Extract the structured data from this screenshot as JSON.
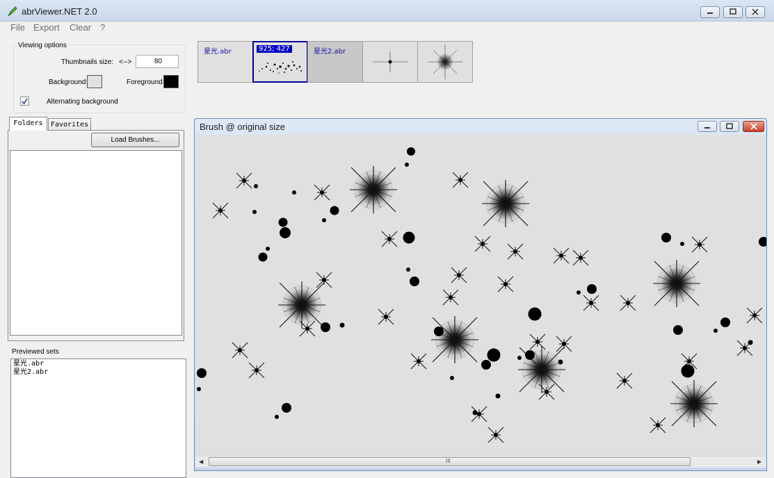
{
  "window": {
    "title": "abrViewer.NET 2.0"
  },
  "menu": {
    "items": [
      "File",
      "Export",
      "Clear",
      "?"
    ]
  },
  "viewing_options": {
    "title": "Viewing options",
    "thumbnails_size_label": "Thumbnails size:",
    "thumbnails_size_arrow": "<-->",
    "thumbnails_size_value": "80",
    "background_label": "Background:",
    "background_color": "#e0e0e0",
    "foreground_label": "Foreground:",
    "foreground_color": "#000000",
    "alternating_label": "Alternating background",
    "alternating_checked": true
  },
  "tabs": {
    "folders": "Folders",
    "favorites": "Favorites",
    "active": "Folders"
  },
  "load_button": "Load Brushes...",
  "previewed_sets": {
    "title": "Previewed sets",
    "items": [
      "星光.abr",
      "星光2.abr"
    ]
  },
  "thumbnails": [
    {
      "name": "星光.abr",
      "selected": false
    },
    {
      "label": "925; 427",
      "selected": true
    },
    {
      "name": "星光2.abr",
      "selected": false
    },
    {
      "icon": "small-star-brush",
      "selected": false
    },
    {
      "icon": "large-star-brush",
      "selected": false
    }
  ],
  "brush_window": {
    "title": "Brush @ original size",
    "scroll_grip": "III"
  },
  "colors": {
    "selection_border": "#0000a0",
    "selection_label_bg": "#0000c8",
    "set_name_text": "#1212a8"
  }
}
